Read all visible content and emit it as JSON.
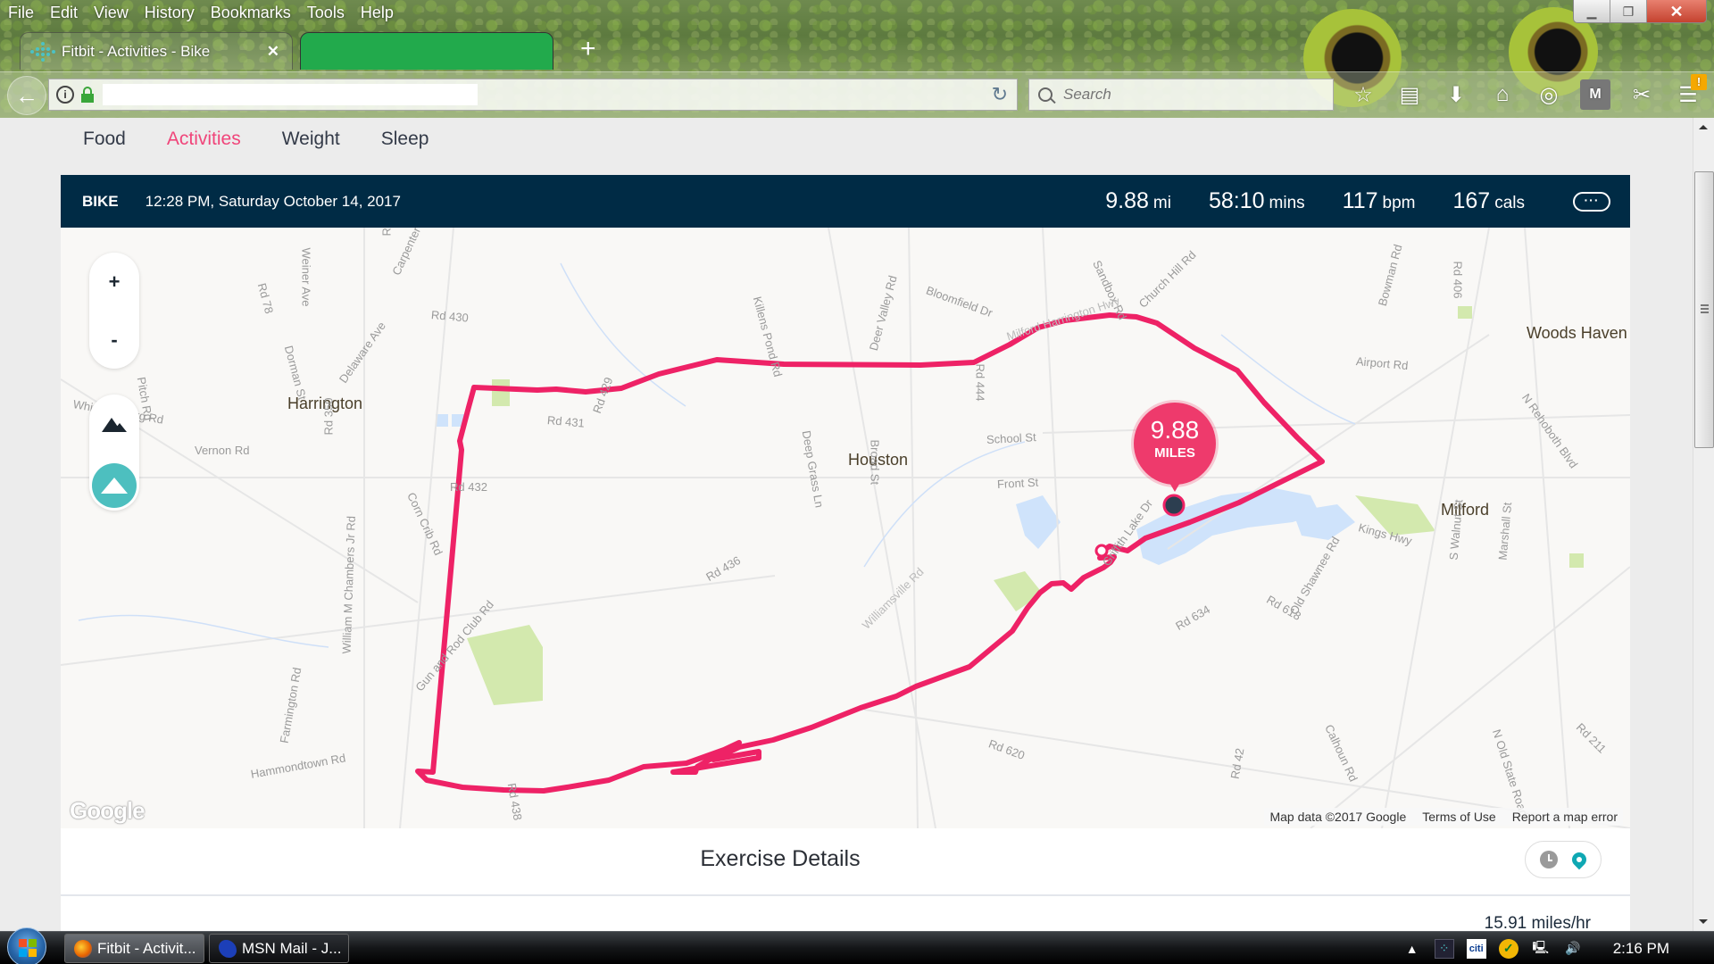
{
  "browser": {
    "menu": [
      "File",
      "Edit",
      "View",
      "History",
      "Bookmarks",
      "Tools",
      "Help"
    ],
    "tabs": [
      {
        "label": "Fitbit - Activities - Bike",
        "active": true
      },
      {
        "label": "",
        "active": false
      }
    ],
    "url": "",
    "search_placeholder": "Search",
    "toolbar_icons": [
      "bookmark-star-icon",
      "reading-list-icon",
      "download-icon",
      "home-icon",
      "pocket-icon",
      "mcafee-icon",
      "screenshot-icon",
      "menu-icon"
    ],
    "menu_badge": "!"
  },
  "page": {
    "nav": [
      {
        "label": "Food",
        "active": false
      },
      {
        "label": "Activities",
        "active": true
      },
      {
        "label": "Weight",
        "active": false
      },
      {
        "label": "Sleep",
        "active": false
      }
    ],
    "activity": {
      "type": "BIKE",
      "datetime": "12:28 PM, Saturday October 14, 2017",
      "stats": [
        {
          "value": "9.88",
          "unit": "mi"
        },
        {
          "value": "58:10",
          "unit": "mins"
        },
        {
          "value": "117",
          "unit": "bpm"
        },
        {
          "value": "167",
          "unit": "cals"
        }
      ],
      "more_label": "···"
    },
    "map": {
      "zoom_in": "+",
      "zoom_out": "-",
      "distance_pin": {
        "value": "9.88",
        "unit": "MILES"
      },
      "route_color": "#ee2266",
      "towns": [
        "Harrington",
        "Houston",
        "Milford",
        "Woods Haven"
      ],
      "roads": [
        "Rd 78",
        "Weiner Ave",
        "Raughley",
        "Carpenter",
        "Rd 430",
        "Delaware Ave",
        "Dorman St",
        "Pitch Rd",
        "Whiteleysburg Rd",
        "Vernon Rd",
        "Rd 350",
        "Rd 431",
        "Rd 429",
        "Rd 432",
        "Corn Crib Rd",
        "William M Chambers Jr Rd",
        "Gun and Rod Club Rd",
        "Farmington Rd",
        "Hammondtown Rd",
        "Rd 438",
        "Rd 436",
        "Killens Pond Rd",
        "Deep Grass Ln",
        "Deer Valley Rd",
        "Broad St",
        "Bloomfield Dr",
        "Rd 444",
        "School St",
        "Front St",
        "Sandbox Rd",
        "Church Hill Rd",
        "Bowman Rd",
        "Rd 406",
        "Airport Rd",
        "N Rehoboth Blvd",
        "Kings Hwy",
        "Griffith Lake Dr",
        "Rd 634",
        "Rd 618",
        "Old Shawnee Rd",
        "S Walnut St",
        "Marshall St",
        "Calhoun Rd",
        "N Old State Road",
        "Rd 620",
        "Rd 42",
        "Rd 211",
        "Milford Harrington Hwy",
        "Williamsville Rd"
      ],
      "logo": "Google",
      "attribution": [
        "Map data ©2017 Google",
        "Terms of Use",
        "Report a map error"
      ]
    },
    "details": {
      "title": "Exercise Details",
      "speed": "15.91 miles/hr"
    }
  },
  "taskbar": {
    "items": [
      "Fitbit - Activit...",
      "MSN Mail - J..."
    ],
    "clock": "2:16 PM"
  }
}
